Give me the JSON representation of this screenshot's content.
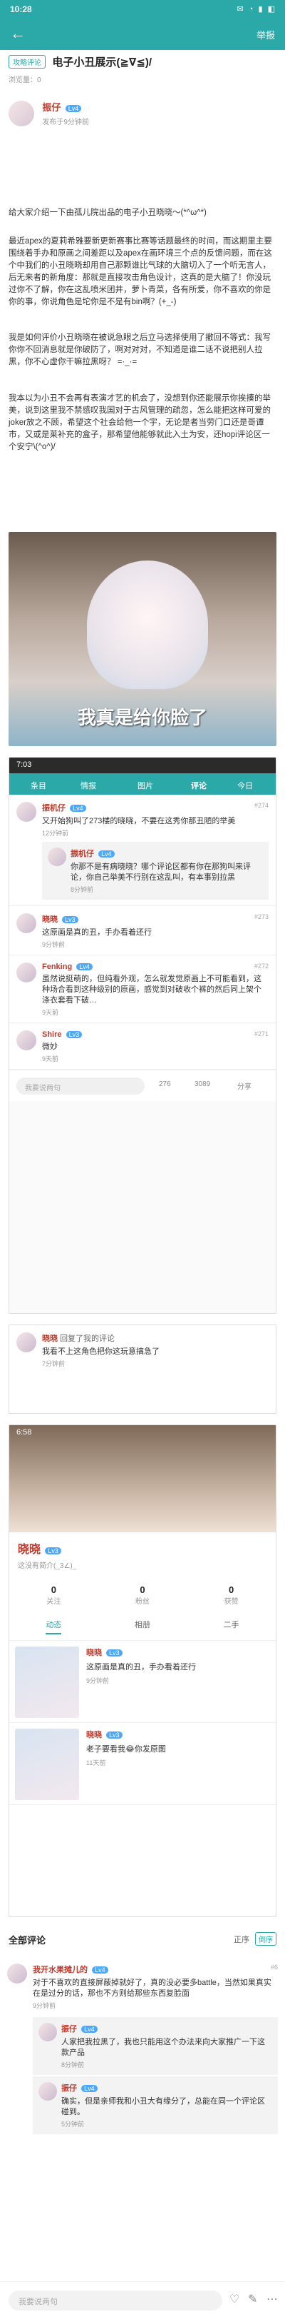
{
  "status": {
    "time": "10:28",
    "icons": "✉ ◔ ▮ ◧"
  },
  "topbar": {
    "back": "←",
    "share": "举报"
  },
  "post": {
    "tag": "攻略评论",
    "title": "电子小丑展示(≧∇≦)/",
    "meta": "浏览量：0"
  },
  "author": {
    "name": "振仔",
    "level": "Lv4",
    "time": "发布于9分钟前"
  },
  "body": {
    "p1": "给大家介绍一下由孤儿院出品的电子小丑晓晓～(*^ω^*)",
    "p2": "最近apex的夏莉希雅要新更新赛事比赛等话题最终的时间，而这期里主要围绕着手办和原画之间差距以及apex在画环境三个点的反馈问题，而在这个中我们的小丑晓晓却用自己那颗谁比气球的大脑切入了一个听无言人，后无来者的新角度：那就是直接攻击角色设计，这真的是大脑了！你没玩过你不了解，你在这乱喷米团井，萝卜青菜，各有所爱，你不喜欢的你是你的事，你说角色是坨你是不是有bin啊？(+_-)",
    "p3": "我是如何评价小丑晓晓在被说急眼之后立马选择使用了撤回不等式：我写你你不回消息就是你破防了，啊对对对，不知道是谁二话不说把别人拉黑，你不心虚你干嘛拉黑呀？ =·_·=",
    "p4": "我本以为小丑不会再有表演才艺的机会了，没想到你还能展示你挨揍的举美，说到这里我不禁感叹我国对于古风管理的疏忽，怎么能把这样可爱的joker放之不顾，希望这个社会给他一个宇，无论是者当劳门口还是哥谭市，又或是莱补充的盒子，那希望他能够就此入土为安，还hopi评论区一个安宁\\(^o^)/"
  },
  "pic1": {
    "caption": "我真是给你脸了"
  },
  "pic2": {
    "time": "7:03",
    "tabs": [
      "条目",
      "情报",
      "图片",
      "评论",
      "今日"
    ],
    "comments": [
      {
        "name": "振机仔",
        "lv": "Lv4",
        "floor": "#274",
        "text": "又开始狗叫了273楼的晓晓，不要在这秀你那丑陋的举美",
        "time": "12分钟前"
      },
      {
        "name": "振机仔",
        "lv": "Lv4",
        "floor": "",
        "text": "你那不是有病晓晓？哪个评论区都有你在那狗叫来评论，你自己举美不行别在这乱叫，有本事别拉黑",
        "time": "8分钟前"
      },
      {
        "name": "晓晓",
        "lv": "Lv3",
        "floor": "#273",
        "text": "这原画是真的丑，手办看着还行",
        "time": "9分钟前"
      },
      {
        "name": "Fenking",
        "lv": "Lv4",
        "floor": "#272",
        "text": "虽然说挺萌的，但纯看外观，怎么就发觉原画上不可能看到，这种场合看到这种级别的原画，感觉到对破收个裤的然后同上架个涤衣套看下破…",
        "time": "9天前"
      },
      {
        "name": "Shire",
        "lv": "Lv3",
        "floor": "#271",
        "text": "微妙",
        "time": "9天前"
      }
    ],
    "input": "我要说两句",
    "likes": "276",
    "fav": "3089",
    "share": "分享"
  },
  "pic3": {
    "name": "晓晓",
    "action": "回复了我的评论",
    "text": "我看不上这角色把你这玩意搞急了",
    "time": "7分钟前"
  },
  "pic4": {
    "time": "6:58",
    "name": "晓晓",
    "lv": "Lv3",
    "bio": "这没有简介(_3∠)_",
    "follow": "关注",
    "fans": "粉丝",
    "collected": "获赞",
    "stats": [
      {
        "v": "0",
        "l": "关注"
      },
      {
        "v": "0",
        "l": "粉丝"
      },
      {
        "v": "0",
        "l": "获赞"
      }
    ],
    "tabs": [
      "动态",
      "相册",
      "二手"
    ],
    "items": [
      {
        "name": "晓晓",
        "lv": "Lv3",
        "text": "这原画是真的丑，手办看着还行",
        "time": "9分钟前"
      },
      {
        "name": "晓晓",
        "lv": "Lv3",
        "text": "老子要看我😂你发原图",
        "time": "11天前"
      }
    ]
  },
  "comments": {
    "label": "全部评论",
    "order": "正序",
    "reverse": "倒序",
    "list": [
      {
        "name": "我开水果摊儿的",
        "lv": "Lv4",
        "text": "对于不喜欢的直接屏蔽掉就好了，真的没必要多battle，当然如果真实在是过分的话，那也不方则给那些东西复脸面",
        "time": "9分钟前",
        "floor": "#6"
      },
      {
        "name": "振仔",
        "lv": "Lv4",
        "text": "人家把我拉黑了，我也只能用这个办法来向大家推广一下这款产品",
        "time": "8分钟前"
      },
      {
        "name": "振仔",
        "lv": "Lv4",
        "text": "确实，但是亲师我和小丑大有缘分了，总能在同一个评论区碰到。",
        "time": "5分钟前"
      }
    ]
  },
  "bottom": {
    "input": "我要说两句",
    "like": "♡",
    "comment": "✎",
    "more": "⋯"
  }
}
